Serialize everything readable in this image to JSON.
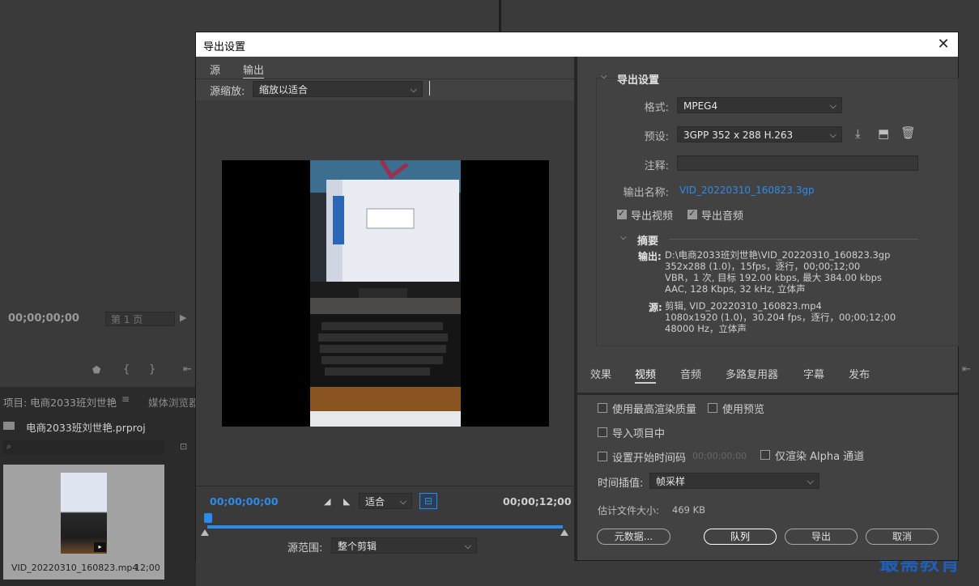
{
  "background": {
    "timecode": "00;00;00;00",
    "page_select": "第 1 页",
    "project_title": "项目: 电商2033班刘世艳",
    "media_browser": "媒体浏览器",
    "project_file": "电商2033班刘世艳.prproj",
    "clip_name": "VID_20220310_160823.mp4",
    "clip_duration": "12;00",
    "watermark": "最需教育"
  },
  "dialog": {
    "title": "导出设置",
    "close_glyph": "✕",
    "left": {
      "tabs": [
        "源",
        "输出"
      ],
      "source_scaling_label": "源缩放:",
      "source_scaling_value": "缩放以适合",
      "timecode_start": "00;00;00;00",
      "timecode_end": "00;00;12;00",
      "fit_value": "适合",
      "source_range_label": "源范围:",
      "source_range_value": "整个剪辑"
    },
    "export_settings": {
      "section_title": "导出设置",
      "format_label": "格式:",
      "format_value": "MPEG4",
      "preset_label": "预设:",
      "preset_value": "3GPP 352 x 288 H.263",
      "comment_label": "注释:",
      "comment_value": "",
      "output_name_label": "输出名称:",
      "output_name_value": "VID_20220310_160823.3gp",
      "export_video_label": "导出视频",
      "export_audio_label": "导出音频",
      "export_video_checked": true,
      "export_audio_checked": true
    },
    "summary": {
      "title": "摘要",
      "output_label": "输出:",
      "output_lines": [
        "D:\\电商2033班刘世艳\\VID_20220310_160823.3gp",
        "352x288 (1.0)，15fps，逐行，00;00;12;00",
        "VBR，1 次, 目标 192.00 kbps, 最大 384.00 kbps",
        "AAC, 128 Kbps, 32  kHz, 立体声"
      ],
      "source_label": "源:",
      "source_lines": [
        "剪辑, VID_20220310_160823.mp4",
        "1080x1920 (1.0)，30.204 fps，逐行，00;00;12;00",
        "48000 Hz，立体声"
      ]
    },
    "tabs": [
      "效果",
      "视频",
      "音频",
      "多路复用器",
      "字幕",
      "发布"
    ],
    "options": {
      "max_render_quality": "使用最高渲染质量",
      "use_previews": "使用预览",
      "import_into_project": "导入项目中",
      "set_start_timecode": "设置开始时间码",
      "start_timecode_value": "00;00;00;00",
      "render_alpha_only": "仅渲染 Alpha 通道",
      "time_interpolation_label": "时间插值:",
      "time_interpolation_value": "帧采样",
      "estimated_size_label": "估计文件大小:",
      "estimated_size_value": "469 KB"
    },
    "buttons": {
      "metadata": "元数据...",
      "queue": "队列",
      "export": "导出",
      "cancel": "取消"
    }
  }
}
